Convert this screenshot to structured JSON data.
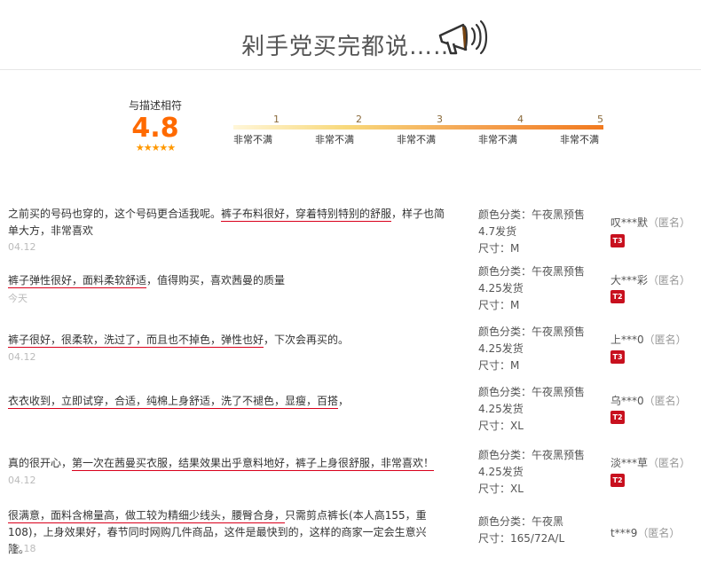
{
  "header": {
    "title": "剁手党买完都说……"
  },
  "rating": {
    "label": "与描述相符",
    "score": "4.8",
    "stars": "★★★★★",
    "scale_numbers": [
      "1",
      "2",
      "3",
      "4",
      "5"
    ],
    "scale_labels": [
      "非常不满",
      "非常不满",
      "非常不满",
      "非常不满",
      "非常不满"
    ]
  },
  "reviews": [
    {
      "text_a": "之前买的号码也穿的，这个号码更合适我呢。",
      "text_u1": "裤子布料很好，穿着特别特别的舒服",
      "text_b": "，样子也简单大方，非常喜欢",
      "date": "04.12",
      "color_line": "颜色分类：午夜黑预售",
      "ship_line": "4.7发货",
      "size_line": "尺寸：M",
      "user": "叹***默",
      "anon": "（匿名）",
      "badge": "T3"
    },
    {
      "text_u1": "裤子弹性很好，面料柔软舒适",
      "text_b": "，值得购买，喜欢茜曼的质量",
      "date": "今天",
      "color_line": "颜色分类：午夜黑预售",
      "ship_line": "4.25发货",
      "size_line": "尺寸：M",
      "user": "大***彩",
      "anon": "（匿名）",
      "badge": "T2"
    },
    {
      "text_u1": "裤子很好，很柔软，洗过了，而且也不掉色，弹性也好",
      "text_b": "，下次会再买的。",
      "date": "04.12",
      "color_line": "颜色分类：午夜黑预售",
      "ship_line": "4.25发货",
      "size_line": "尺寸：M",
      "user": "上***0",
      "anon": "（匿名）",
      "badge": "T3"
    },
    {
      "text_u1": "衣衣收到，立即试穿，合适，纯棉上身舒适，洗了不褪色，显瘦，百搭",
      "text_b": "，",
      "date": "04.12",
      "color_line": "颜色分类：午夜黑预售",
      "ship_line": "4.25发货",
      "size_line": "尺寸：XL",
      "user": "乌***0",
      "anon": "（匿名）",
      "badge": "T2"
    },
    {
      "text_a": "真的很开心，",
      "text_u1": "第一次在茜曼买衣服，结果效果出乎意料地好，裤子上身很舒服，非常喜欢！",
      "date": "04.12",
      "color_line": "颜色分类：午夜黑预售",
      "ship_line": "4.25发货",
      "size_line": "尺寸：XL",
      "user": "淡***草",
      "anon": "（匿名）",
      "badge": "T2"
    },
    {
      "text_u1": "很满意，面料含棉量高，做工较为精细少线头，腰臀合身，",
      "text_b": "只需剪点裤长(本人高155，重108)，上身效果好，春节同时网购几件商品，这件是最快到的，这样的商家一定会生意兴隆。",
      "date": "02.18",
      "color_line": "颜色分类：午夜黑",
      "size_line": "尺寸：165/72A/L",
      "user": "t***9",
      "anon": "（匿名）"
    }
  ]
}
